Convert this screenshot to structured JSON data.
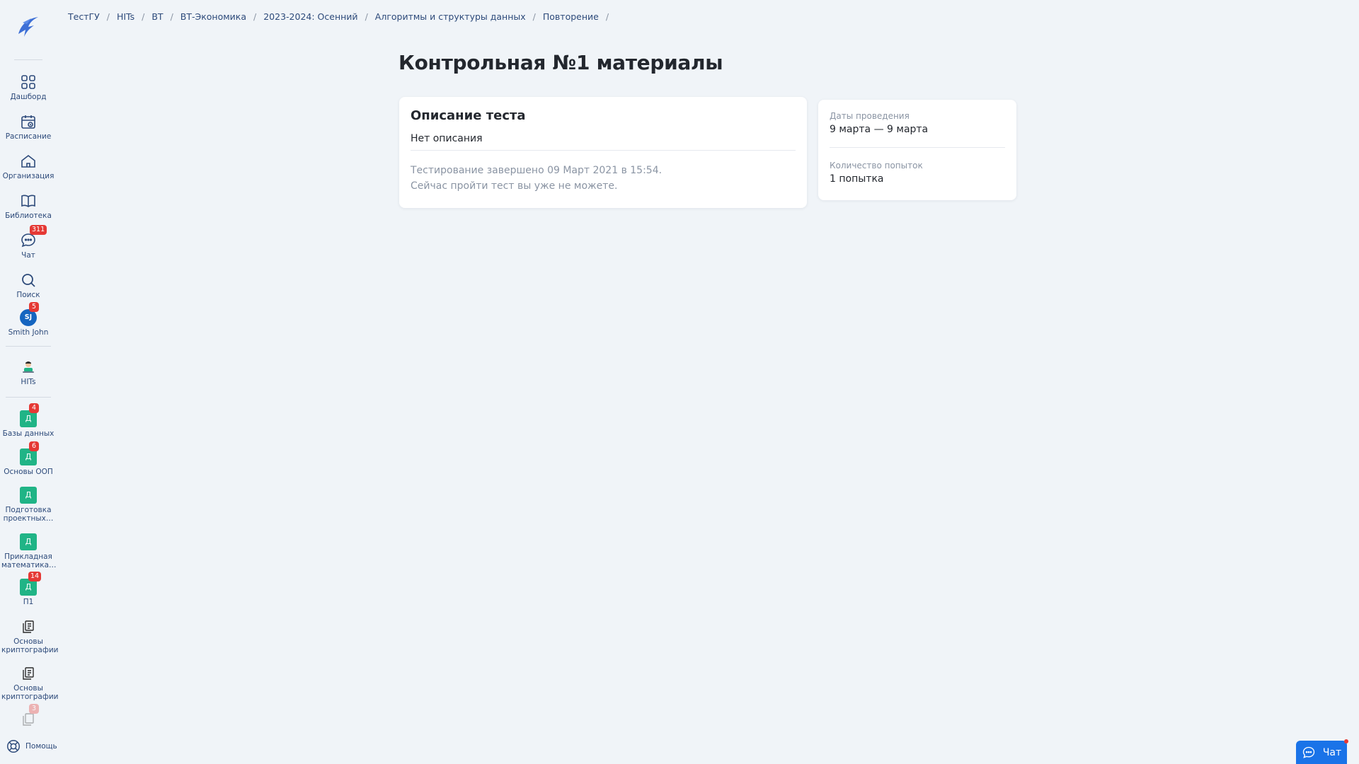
{
  "sidebar": {
    "items": [
      {
        "label": "Дашборд"
      },
      {
        "label": "Расписание"
      },
      {
        "label": "Организация"
      },
      {
        "label": "Библиотека"
      },
      {
        "label": "Чат",
        "badge": "311"
      },
      {
        "label": "Поиск"
      },
      {
        "label": "Smith John",
        "avatar": "SJ",
        "badge": "5"
      },
      {
        "label": "HITs"
      },
      {
        "label": "Базы данных",
        "letter": "Д",
        "badge": "4"
      },
      {
        "label": "Основы ООП",
        "letter": "Д",
        "badge": "6"
      },
      {
        "label": "Подготовка проектных…",
        "letter": "Д"
      },
      {
        "label": "Прикладная математика…",
        "letter": "Д"
      },
      {
        "label": "П1",
        "letter": "Д",
        "badge": "14"
      },
      {
        "label": "Основы криптографии"
      },
      {
        "label": "Основы криптографии"
      },
      {
        "badge": "3"
      }
    ],
    "help_label": "Помощь"
  },
  "breadcrumb": [
    "ТестГУ",
    "HITs",
    "ВТ",
    "ВТ-Экономика",
    "2023-2024: Осенний",
    "Алгоритмы и структуры данных",
    "Повторение"
  ],
  "page_title": "Контрольная №1 материалы",
  "description": {
    "title": "Описание теста",
    "text": "Нет описания",
    "note_line1": "Тестирование завершено 09 Март 2021 в 15:54.",
    "note_line2": "Сейчас пройти тест вы уже не можете."
  },
  "info": {
    "dates_label": "Даты проведения",
    "dates_value": "9 марта — 9 марта",
    "attempts_label": "Количество попыток",
    "attempts_value": "1 попытка"
  },
  "chat_button": {
    "label": "Чат"
  },
  "colors": {
    "accent": "#1a73e8",
    "course": "#20b486",
    "badge": "#e53935",
    "avatar": "#1565c0"
  }
}
